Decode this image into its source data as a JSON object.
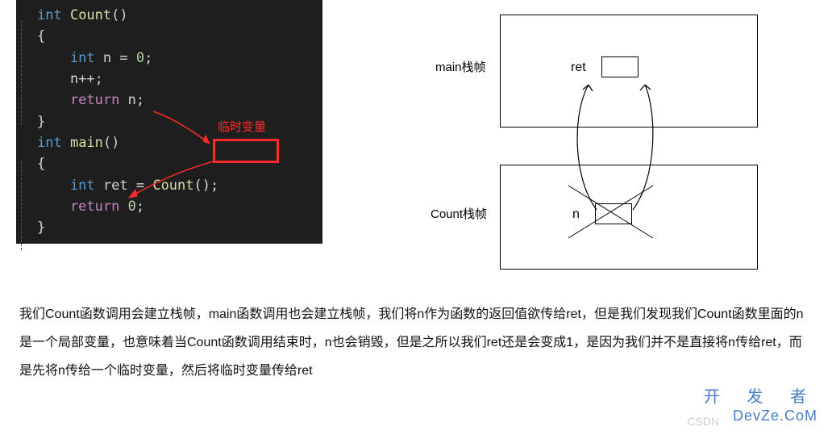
{
  "code": {
    "l1_type": "int",
    "l1_fn": " Count",
    "l1_paren": "()",
    "l2": "{",
    "l3_type": "    int",
    "l3_ident": " n",
    "l3_eq": " = ",
    "l3_num": "0",
    "l3_semi": ";",
    "l4": "    n",
    "l4_op": "++;",
    "l5_kw": "    return",
    "l5_ident": " n",
    "l5_semi": ";",
    "l6": "}",
    "l7_type": "int",
    "l7_fn": " main",
    "l7_paren": "()",
    "l8": "{",
    "l9_type": "    int",
    "l9_ident": " ret",
    "l9_eq": " = ",
    "l9_call": "Count",
    "l9_paren": "();",
    "l10_kw": "    return",
    "l10_num": " 0",
    "l10_semi": ";",
    "l11": "}"
  },
  "red_label": "临时变量",
  "diagram": {
    "main_frame": "main栈帧",
    "count_frame": "Count栈帧",
    "ret": "ret",
    "n": "n"
  },
  "explanation": "我们Count函数调用会建立栈帧，main函数调用也会建立栈帧，我们将n作为函数的返回值欲传给ret，但是我们发现我们Count函数里面的n是一个局部变量，也意味着当Count函数调用结束时，n也会销毁，但是之所以我们ret还是会变成1，是因为我们并不是直接将n传给ret，而是先将n传给一个临时变量，然后将临时变量传给ret",
  "watermark": {
    "top": "开 发 者",
    "bottom": "DevZe.CoM",
    "csdn": "CSDN"
  }
}
